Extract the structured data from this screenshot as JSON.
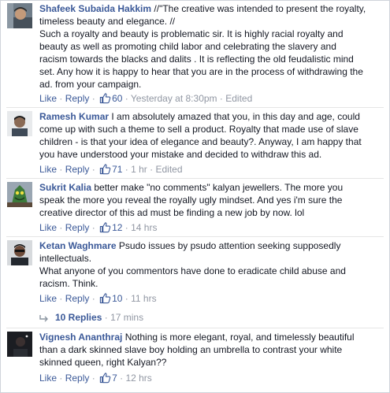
{
  "comments": [
    {
      "author": "Shafeek Subaida Hakkim",
      "lines": [
        "//\"The creative was intended to present the royalty,",
        "timeless beauty and elegance. //",
        "Such a royalty and beauty is problematic sir. It is highly racial royalty and",
        "beauty as well as promoting child labor and celebrating the slavery and",
        "racism towards the blacks and dalits . It is reflecting the old feudalistic mind",
        "set. Any how it is happy to hear that you are in the process of withdrawing the",
        "ad. from your campaign."
      ],
      "like": "Like",
      "reply": "Reply",
      "likes": "60",
      "time": "Yesterday at 8:30pm",
      "edited": "Edited"
    },
    {
      "author": "Ramesh Kumar",
      "lines": [
        "I am absolutely amazed that you, in this day and age, could",
        "come up with such a theme to sell a product. Royalty that made use of slave",
        "children - is that your idea of elegance and beauty?. Anyway, I am happy that",
        "you have understood your mistake and decided to withdraw this ad."
      ],
      "like": "Like",
      "reply": "Reply",
      "likes": "71",
      "time": "1 hr",
      "edited": "Edited"
    },
    {
      "author": "Sukrit Kalia",
      "lines": [
        "better make \"no comments\" kalyan jewellers. The more you",
        "speak the more you reveal the royally ugly mindset. And yes i'm sure the",
        "creative director of this ad must be finding a new job by now. lol"
      ],
      "like": "Like",
      "reply": "Reply",
      "likes": "12",
      "time": "14 hrs"
    },
    {
      "author": "Ketan Waghmare",
      "lines": [
        "Psudo issues by psudo attention seeking supposedly",
        "intellectuals.",
        "What anyone of you commentors have done to eradicate child abuse and",
        "racism. Think."
      ],
      "like": "Like",
      "reply": "Reply",
      "likes": "10",
      "time": "11 hrs",
      "replies_label": "10 Replies",
      "replies_time": "17 mins"
    },
    {
      "author": "Vignesh Ananthraj",
      "lines": [
        "Nothing is more elegant, royal, and timelessly beautiful",
        "than a dark skinned slave boy holding an umbrella to contrast your white",
        "skinned queen, right Kalyan??"
      ],
      "like": "Like",
      "reply": "Reply",
      "likes": "7",
      "time": "12 hrs"
    }
  ],
  "icons": {
    "like_count": "thumbs-up-icon",
    "replies": "reply-arrow-icon"
  },
  "colors": {
    "link": "#3b5998",
    "meta": "#9197a3",
    "text": "#141823"
  }
}
